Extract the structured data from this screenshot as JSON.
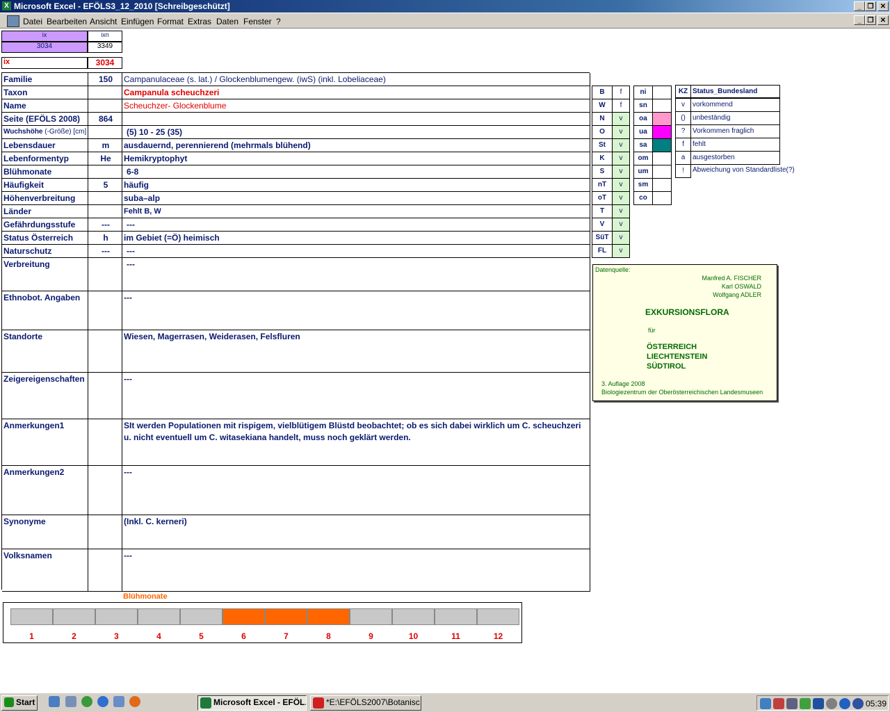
{
  "window": {
    "title": "Microsoft Excel - EFÖLS3_12_2010  [Schreibgeschützt]"
  },
  "menu": [
    "Datei",
    "Bearbeiten",
    "Ansicht",
    "Einfügen",
    "Format",
    "Extras",
    "Daten",
    "Fenster",
    "?"
  ],
  "index": {
    "ix_label": "ix",
    "ixn_label": "ixn",
    "ix_value": "3034",
    "ixn_value": "3349",
    "big_label": "ix",
    "big_value": "3034"
  },
  "rows": [
    {
      "label": "Familie",
      "code": "150",
      "text": "Campanulaceae (s. lat.)  /  Glockenblumengew. (iwS) (inkl. Lobeliaceae)"
    },
    {
      "label": "Taxon",
      "code": "",
      "text": "Campanula scheuchzeri"
    },
    {
      "label": "Name",
      "code": "",
      "text": "Scheuchzer- Glockenblume"
    },
    {
      "label": "Seite (EFÖLS 2008)",
      "code": "864",
      "text": ""
    },
    {
      "label": "Wuchshöhe",
      "label_suffix": "(-Größe) [cm]",
      "code": "",
      "text": "(5) 10 - 25 (35)"
    },
    {
      "label": "Lebensdauer",
      "code": "m",
      "text": "ausdauernd, perennierend (mehrmals blühend)"
    },
    {
      "label": "Lebenformentyp",
      "code": "He",
      "text": "Hemikryptophyt"
    },
    {
      "label": "Blühmonate",
      "code": "",
      "text": "6-8"
    },
    {
      "label": "Häufigkeit",
      "code": "5",
      "text": "häufig"
    },
    {
      "label": "Höhenverbreitung",
      "code": "",
      "text": "suba–alp"
    },
    {
      "label": "Länder",
      "code": "",
      "text": "Fehlt B, W"
    },
    {
      "label": "Gefährdungsstufe",
      "code": "---",
      "text": "---"
    },
    {
      "label": "Status Österreich",
      "code": "h",
      "text": "im Gebiet (=Ö) heimisch"
    },
    {
      "label": "Naturschutz",
      "code": "---",
      "text": "---"
    },
    {
      "label": "Verbreitung",
      "code": "",
      "text": "---"
    },
    {
      "label": "Ethnobot. Angaben",
      "code": "",
      "text": "---"
    },
    {
      "label": "Standorte",
      "code": "",
      "text": "Wiesen, Magerrasen, Weiderasen, Felsfluren"
    },
    {
      "label": "Zeigereigenschaften",
      "code": "",
      "text": "---"
    },
    {
      "label": "Anmerkungen1",
      "code": "",
      "text": "SIt werden Populationen mit rispigem, vielblütigem Blüstd beobachtet; ob es sich dabei wirklich um C. scheuchzeri u. nicht eventuell um C. witasekiana handelt, muss noch geklärt werden."
    },
    {
      "label": "Anmerkungen2",
      "code": "",
      "text": "---"
    },
    {
      "label": "Synonyme",
      "code": "",
      "text": "(Inkl. C. kerneri)"
    },
    {
      "label": "Volksnamen",
      "code": "",
      "text": "---"
    }
  ],
  "regions": [
    {
      "k": "B",
      "v": "f"
    },
    {
      "k": "W",
      "v": "f"
    },
    {
      "k": "N",
      "v": "v"
    },
    {
      "k": "O",
      "v": "v"
    },
    {
      "k": "St",
      "v": "v"
    },
    {
      "k": "K",
      "v": "v"
    },
    {
      "k": "S",
      "v": "v"
    },
    {
      "k": "nT",
      "v": "v"
    },
    {
      "k": "oT",
      "v": "v"
    },
    {
      "k": "T",
      "v": "v"
    },
    {
      "k": "V",
      "v": "v"
    },
    {
      "k": "SüT",
      "v": "v"
    },
    {
      "k": "FL",
      "v": "v"
    }
  ],
  "zones": [
    {
      "k": "ni",
      "color": ""
    },
    {
      "k": "sn",
      "color": ""
    },
    {
      "k": "oa",
      "color": "#ff99cc"
    },
    {
      "k": "ua",
      "color": "#ff00ff"
    },
    {
      "k": "sa",
      "color": "#008080"
    },
    {
      "k": "om",
      "color": ""
    },
    {
      "k": "um",
      "color": ""
    },
    {
      "k": "sm",
      "color": ""
    },
    {
      "k": "co",
      "color": ""
    }
  ],
  "status_legend": {
    "header_kz": "KZ",
    "header_label": "Status_Bundesland",
    "items": [
      {
        "kz": "v",
        "label": "vorkommend"
      },
      {
        "kz": "()",
        "label": "unbeständig"
      },
      {
        "kz": "?",
        "label": "Vorkommen fraglich"
      },
      {
        "kz": "f",
        "label": "fehlt"
      },
      {
        "kz": "a",
        "label": "ausgestorben"
      },
      {
        "kz": "!",
        "label": "Abweichung von Standardliste(?)"
      }
    ]
  },
  "source": {
    "heading": "Datenquelle:",
    "authors": [
      "Manfred A. FISCHER",
      "Karl OSWALD",
      "Wolfgang ADLER"
    ],
    "title": "EXKURSIONSFLORA",
    "fuer": "für",
    "countries": [
      "ÖSTERREICH",
      "LIECHTENSTEIN",
      "SÜDTIROL"
    ],
    "edition": "3. Auflage 2008",
    "publisher": "Biologiezentrum der Oberösterreichischen Landesmuseen"
  },
  "bloom": {
    "title": "Blühmonate",
    "months": [
      "1",
      "2",
      "3",
      "4",
      "5",
      "6",
      "7",
      "8",
      "9",
      "10",
      "11",
      "12"
    ],
    "active": [
      false,
      false,
      false,
      false,
      false,
      true,
      true,
      true,
      false,
      false,
      false,
      false
    ],
    "active_color": "#ff6600"
  },
  "taskbar": {
    "start": "Start",
    "tasks": [
      "Microsoft Excel - EFÖL...",
      "*E:\\EFÖLS2007\\Botanisc..."
    ],
    "clock": "05:39"
  }
}
